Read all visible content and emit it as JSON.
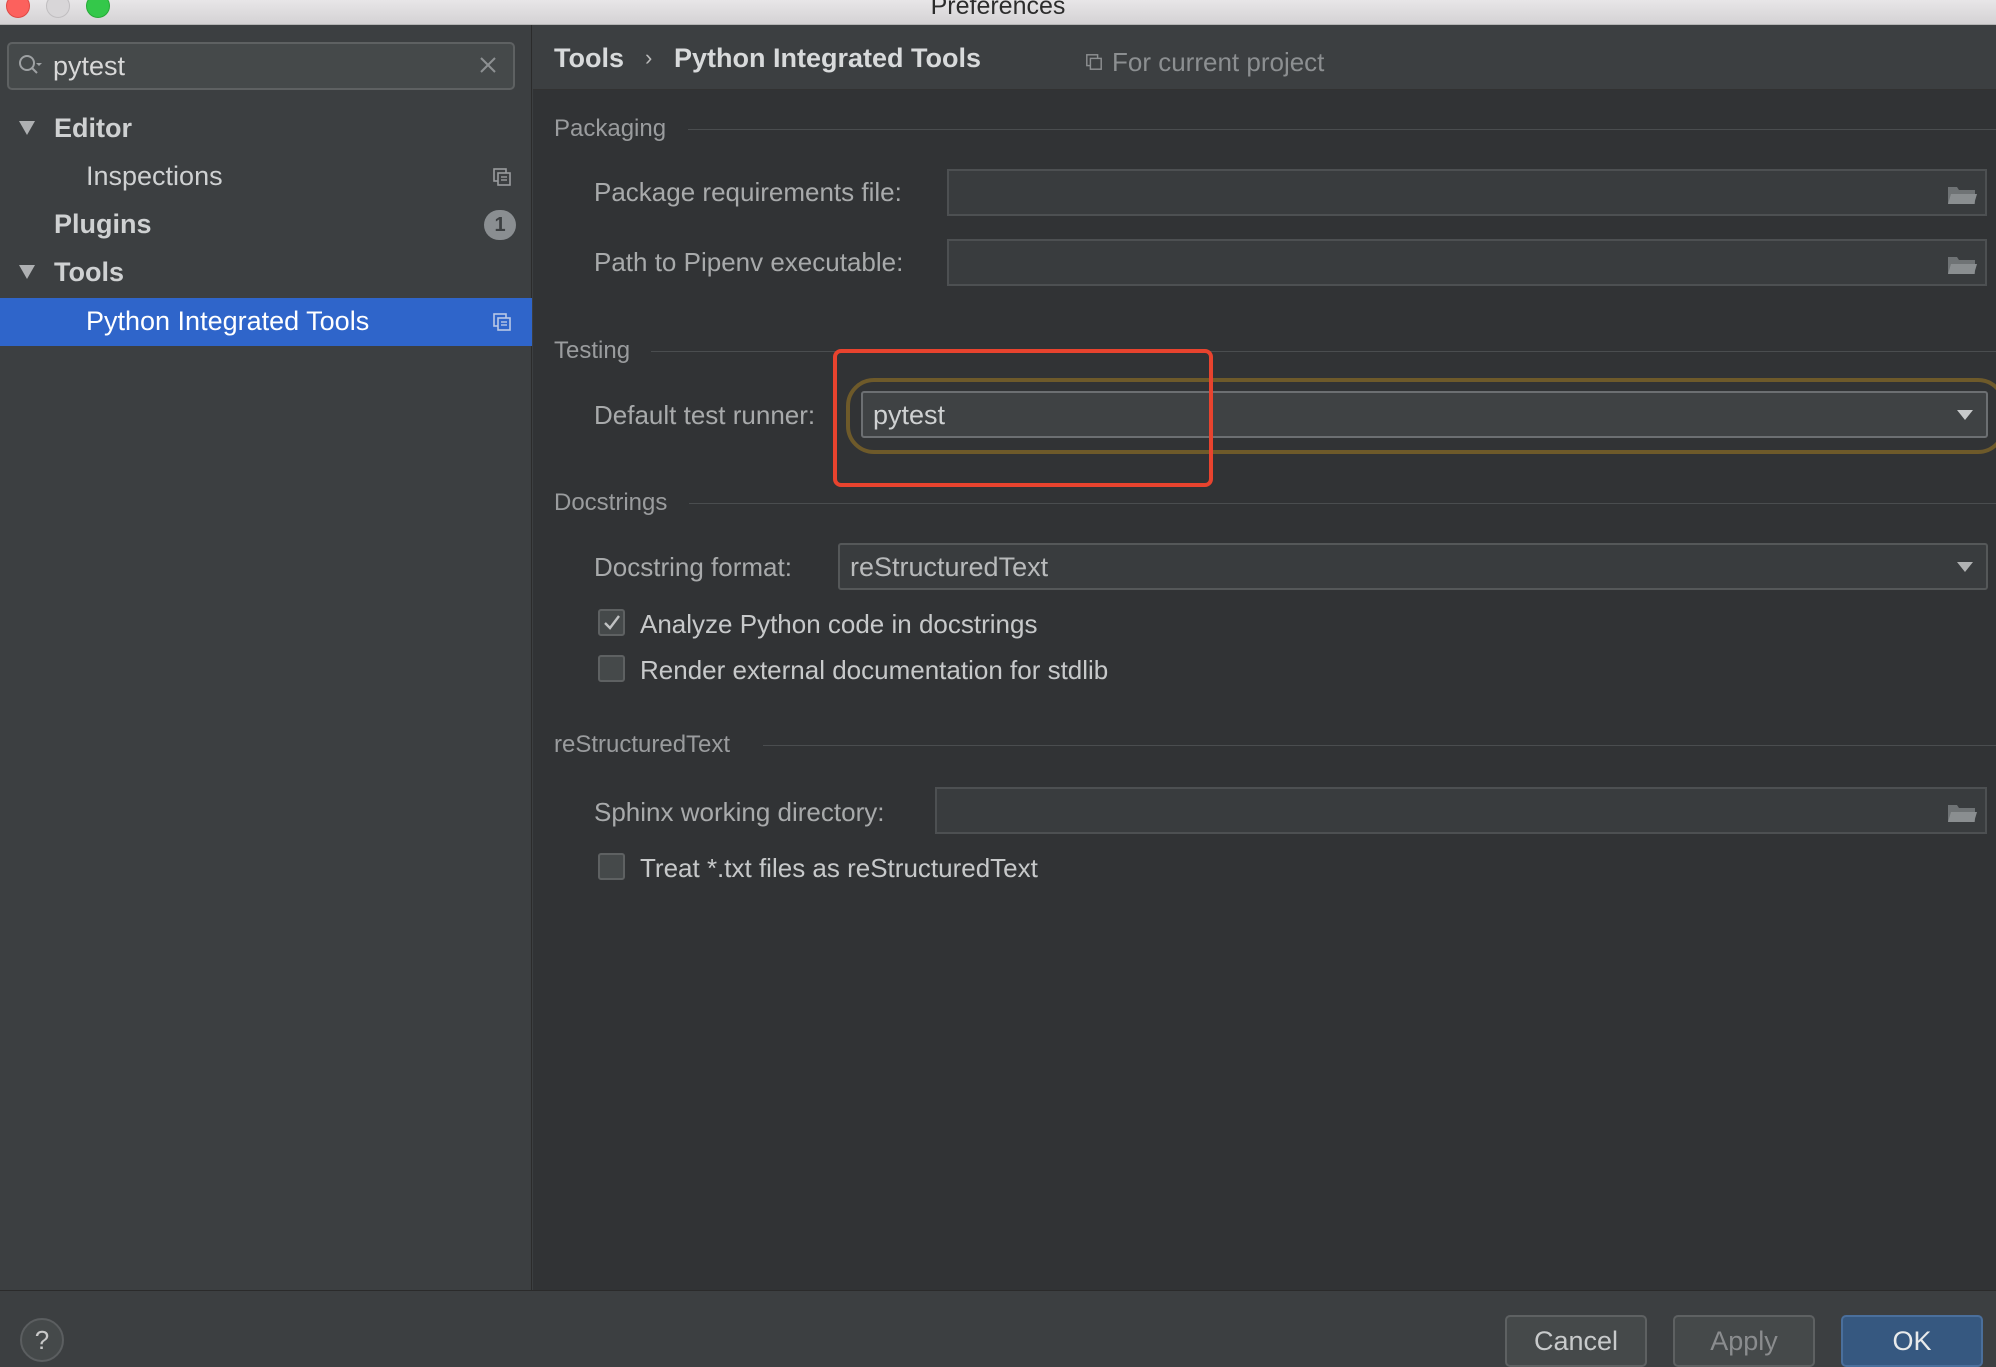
{
  "window": {
    "title": "Preferences"
  },
  "search": {
    "value": "pytest"
  },
  "sidebar": {
    "items": [
      {
        "label": "Editor",
        "expanded": true
      },
      {
        "label": "Inspections"
      },
      {
        "label": "Plugins",
        "badge": "1"
      },
      {
        "label": "Tools",
        "expanded": true
      },
      {
        "label": "Python Integrated Tools",
        "selected": true
      }
    ]
  },
  "breadcrumb": {
    "parent": "Tools",
    "separator": "›",
    "current": "Python Integrated Tools",
    "scope": "For current project"
  },
  "packaging": {
    "section": "Packaging",
    "requirements_label": "Package requirements file:",
    "requirements_value": "",
    "pipenv_label": "Path to Pipenv executable:",
    "pipenv_value": ""
  },
  "testing": {
    "section": "Testing",
    "runner_label": "Default test runner:",
    "runner_value": "pytest"
  },
  "docstrings": {
    "section": "Docstrings",
    "format_label": "Docstring format:",
    "format_value": "reStructuredText",
    "analyze_label": "Analyze Python code in docstrings",
    "analyze_checked": true,
    "render_label": "Render external documentation for stdlib",
    "render_checked": false
  },
  "rest": {
    "section": "reStructuredText",
    "sphinx_label": "Sphinx working directory:",
    "sphinx_value": "",
    "treat_label": "Treat *.txt files as reStructuredText",
    "treat_checked": false
  },
  "footer": {
    "help_label": "?",
    "cancel_label": "Cancel",
    "apply_label": "Apply",
    "ok_label": "OK"
  },
  "colors": {
    "selection": "#2f65ca",
    "highlight_box": "#e8432e",
    "primary_button": "#365880"
  }
}
